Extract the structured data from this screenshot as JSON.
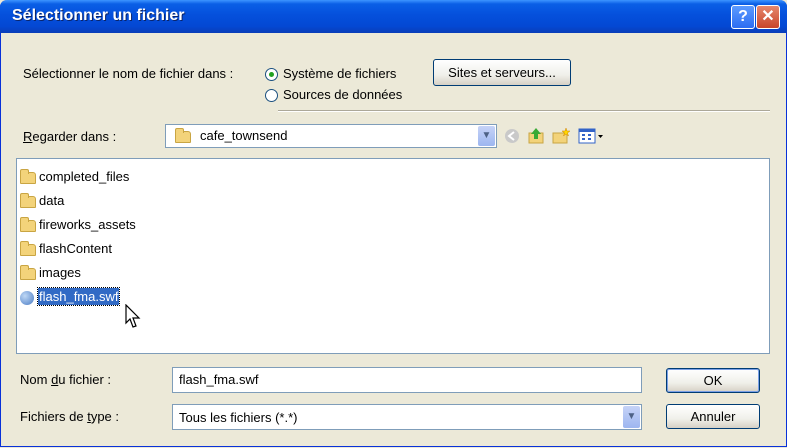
{
  "window": {
    "title": "Sélectionner un fichier",
    "help_glyph": "?",
    "close_glyph": "✕"
  },
  "source": {
    "label": "Sélectionner le nom de fichier dans :",
    "options": [
      {
        "label": "Système de fichiers",
        "selected": true
      },
      {
        "label": "Sources de données",
        "selected": false
      }
    ],
    "sites_button": "Sites et serveurs..."
  },
  "lookin": {
    "label_prefix": "",
    "label_underline": "R",
    "label_rest": "egarder dans :",
    "value": "cafe_townsend"
  },
  "files": [
    {
      "name": "completed_files",
      "type": "folder"
    },
    {
      "name": "data",
      "type": "folder"
    },
    {
      "name": "fireworks_assets",
      "type": "folder"
    },
    {
      "name": "flashContent",
      "type": "folder"
    },
    {
      "name": "images",
      "type": "folder"
    },
    {
      "name": "flash_fma.swf",
      "type": "swf",
      "selected": true
    }
  ],
  "filename": {
    "label_prefix": "Nom ",
    "label_underline": "d",
    "label_rest": "u fichier :",
    "value": "flash_fma.swf"
  },
  "filetype": {
    "label_prefix": "Fichiers de ",
    "label_underline": "t",
    "label_rest": "ype :",
    "value": "Tous les fichiers (*.*)"
  },
  "buttons": {
    "ok": "OK",
    "cancel": "Annuler"
  },
  "colors": {
    "titlebar": "#0550DC",
    "selection": "#316AC5",
    "face": "#ECE9D8"
  }
}
